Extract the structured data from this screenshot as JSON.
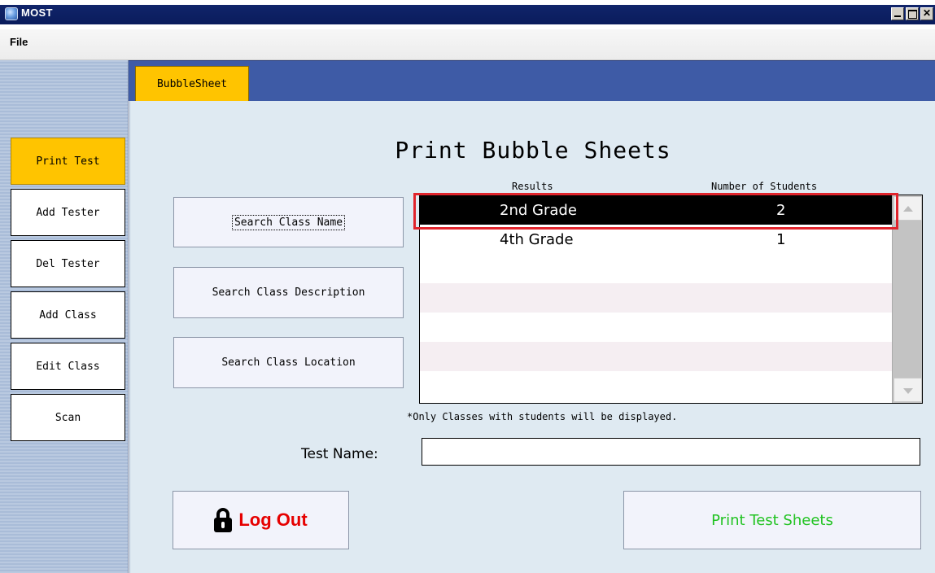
{
  "window": {
    "title": "MOST",
    "icon": "app-globe-icon"
  },
  "menu": {
    "file": "File"
  },
  "sidebar": {
    "items": [
      {
        "label": "Print Test",
        "active": true
      },
      {
        "label": "Add Tester"
      },
      {
        "label": "Del Tester"
      },
      {
        "label": "Add Class"
      },
      {
        "label": "Edit Class"
      },
      {
        "label": "Scan"
      }
    ]
  },
  "tabs": [
    {
      "label": "BubbleSheet",
      "active": true
    }
  ],
  "main": {
    "title": "Print Bubble Sheets",
    "search_buttons": {
      "name": "Search Class Name",
      "description": "Search Class Description",
      "location": "Search Class Location"
    },
    "results": {
      "col_results": "Results",
      "col_students": "Number of Students",
      "rows": [
        {
          "name": "2nd Grade",
          "count": "2",
          "selected": true
        },
        {
          "name": "4th Grade",
          "count": "1"
        }
      ]
    },
    "note": "*Only Classes with students will be displayed.",
    "test_name_label": "Test Name:",
    "test_name_value": "",
    "logout_label": "Log Out",
    "print_label": "Print Test Sheets"
  },
  "colors": {
    "accent_yellow": "#ffc400",
    "tab_strip_blue": "#3e5ba6",
    "logout_red": "#e60000",
    "print_green": "#22c322",
    "selection_outline": "#e0242c"
  }
}
